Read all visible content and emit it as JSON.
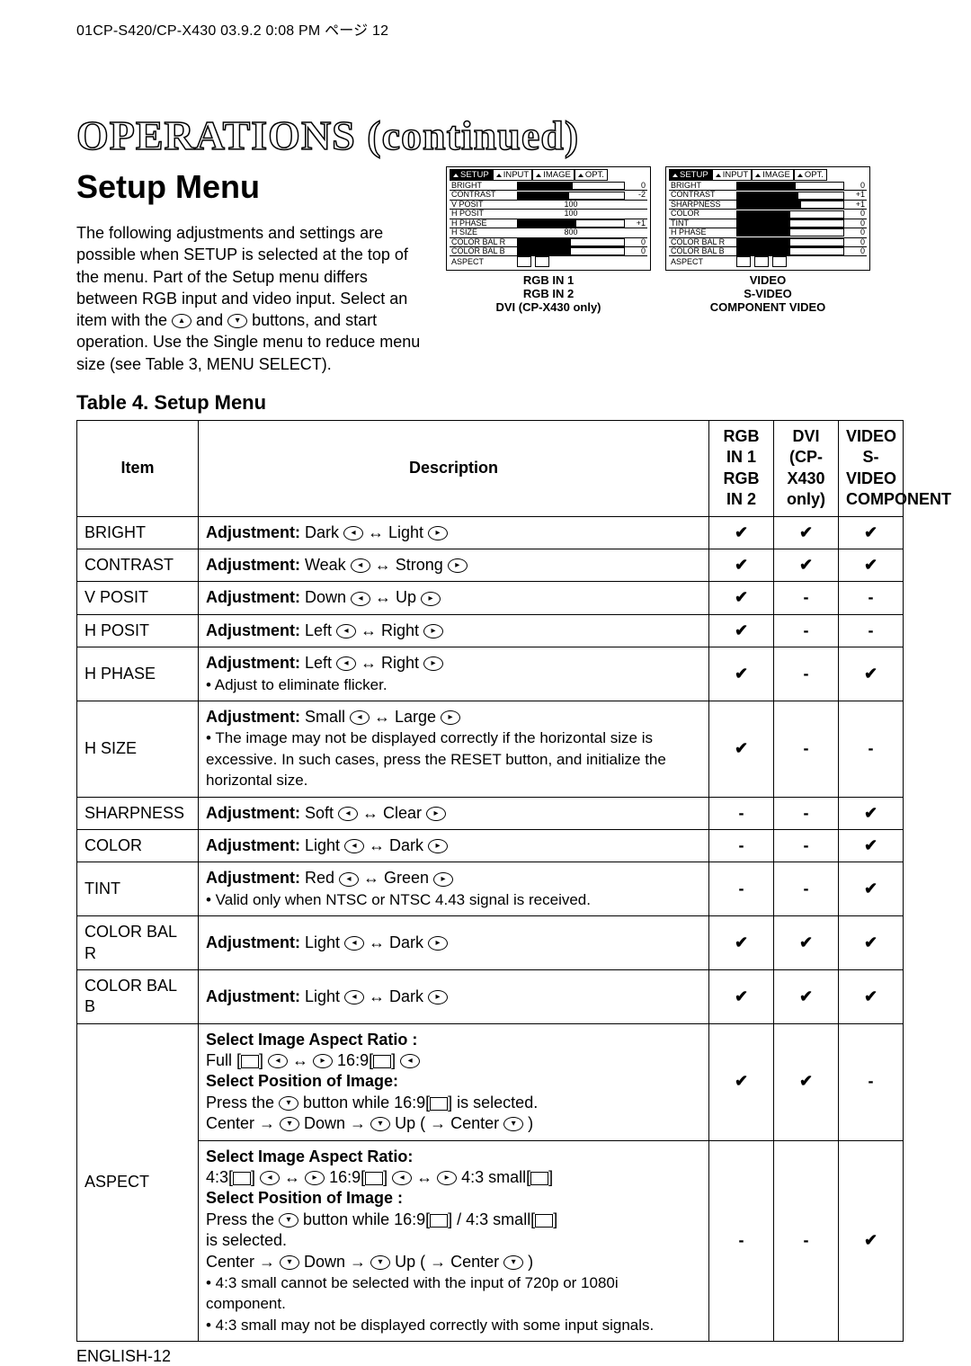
{
  "runhead": "01CP-S420/CP-X430  03.9.2 0:08 PM  ページ 12",
  "title": "OPERATIONS (continued)",
  "section": "Setup Menu",
  "lead_pre": "The following adjustments and settings are possible when SETUP is selected at the top of the menu. Part of the Setup menu differs between RGB input and video input. Select an item with the ",
  "lead_mid": " and ",
  "lead_post": " buttons, and start operation. Use the Single menu to reduce menu size (see Table 3, MENU SELECT).",
  "table_title": "Table 4. Setup Menu",
  "menus": {
    "tabs": [
      "SETUP",
      "INPUT",
      "IMAGE",
      "OPT."
    ],
    "left": {
      "rows": [
        {
          "n": "BRIGHT",
          "f": 52,
          "v": "0"
        },
        {
          "n": "CONTRAST",
          "f": 48,
          "v": "-2"
        },
        {
          "n": "V POSIT",
          "f": 0,
          "v": "100",
          "text": true
        },
        {
          "n": "H POSIT",
          "f": 0,
          "v": "100",
          "text": true
        },
        {
          "n": "H PHASE",
          "f": 55,
          "v": "+1"
        },
        {
          "n": "H SIZE",
          "f": 0,
          "v": "800",
          "text": true
        },
        {
          "n": "COLOR BAL R",
          "f": 50,
          "v": "0"
        },
        {
          "n": "COLOR BAL B",
          "f": 50,
          "v": "0"
        },
        {
          "n": "ASPECT",
          "aspect": true
        }
      ],
      "caption": "RGB IN 1\nRGB IN 2\nDVI (CP-X430 only)"
    },
    "right": {
      "rows": [
        {
          "n": "BRIGHT",
          "f": 55,
          "v": "0"
        },
        {
          "n": "CONTRAST",
          "f": 58,
          "v": "+1"
        },
        {
          "n": "SHARPNESS",
          "f": 60,
          "v": "+1"
        },
        {
          "n": "COLOR",
          "f": 50,
          "v": "0"
        },
        {
          "n": "TINT",
          "f": 50,
          "v": "0"
        },
        {
          "n": "H PHASE",
          "f": 50,
          "v": "0"
        },
        {
          "n": "COLOR BAL R",
          "f": 50,
          "v": "0"
        },
        {
          "n": "COLOR BAL B",
          "f": 50,
          "v": "0"
        },
        {
          "n": "ASPECT",
          "aspect": true,
          "three": true
        }
      ],
      "caption": "VIDEO\nS-VIDEO\nCOMPONENT VIDEO"
    }
  },
  "headers": {
    "item": "Item",
    "desc": "Description",
    "c1": "RGB IN 1\nRGB IN 2",
    "c2": "DVI\n(CP-\nX430\nonly)",
    "c3": "VIDEO\nS-VIDEO\nCOMPONENT"
  },
  "labels": {
    "adj": "Adjustment:"
  },
  "icons": {
    "left": "◂",
    "right": "▸",
    "up": "▴",
    "down": "▾",
    "darr": "↔"
  },
  "rows": [
    {
      "item": "BRIGHT",
      "desc": {
        "adj": true,
        "l": "Dark",
        "r": "Light"
      },
      "a": "✔",
      "b": "✔",
      "c": "✔"
    },
    {
      "item": "CONTRAST",
      "desc": {
        "adj": true,
        "l": "Weak",
        "r": "Strong"
      },
      "a": "✔",
      "b": "✔",
      "c": "✔"
    },
    {
      "item": "V POSIT",
      "desc": {
        "adj": true,
        "l": "Down",
        "r": "Up"
      },
      "a": "✔",
      "b": "-",
      "c": "-"
    },
    {
      "item": "H POSIT",
      "desc": {
        "adj": true,
        "l": "Left",
        "r": "Right"
      },
      "a": "✔",
      "b": "-",
      "c": "-"
    },
    {
      "item": "H PHASE",
      "desc": {
        "adj": true,
        "l": "Left",
        "r": "Right",
        "extra": "• Adjust to eliminate flicker."
      },
      "a": "✔",
      "b": "-",
      "c": "✔"
    },
    {
      "item": "H SIZE",
      "desc": {
        "adj": true,
        "l": "Small",
        "r": "Large",
        "extra": "• The image may not be displayed correctly if the horizontal size is excessive. In such cases, press the RESET button, and initialize the horizontal size."
      },
      "a": "✔",
      "b": "-",
      "c": "-"
    },
    {
      "item": "SHARPNESS",
      "desc": {
        "adj": true,
        "l": "Soft",
        "r": "Clear"
      },
      "a": "-",
      "b": "-",
      "c": "✔"
    },
    {
      "item": "COLOR",
      "desc": {
        "adj": true,
        "l": "Light",
        "r": "Dark"
      },
      "a": "-",
      "b": "-",
      "c": "✔"
    },
    {
      "item": "TINT",
      "desc": {
        "adj": true,
        "l": "Red",
        "r": "Green",
        "extra": "• Valid only when NTSC or NTSC 4.43 signal is received."
      },
      "a": "-",
      "b": "-",
      "c": "✔"
    },
    {
      "item": "COLOR BAL R",
      "desc": {
        "adj": true,
        "l": "Light",
        "r": "Dark"
      },
      "a": "✔",
      "b": "✔",
      "c": "✔"
    },
    {
      "item": "COLOR BAL B",
      "desc": {
        "adj": true,
        "l": "Light",
        "r": "Dark"
      },
      "a": "✔",
      "b": "✔",
      "c": "✔"
    }
  ],
  "aspect": {
    "item": "ASPECT",
    "top": {
      "h1": "Select Image Aspect Ratio :",
      "l1a": "Full [",
      "l1b": "] ",
      "l1c": " 16:9[",
      "l1d": "] ",
      "h2": "Select Position of Image:",
      "l2a": "Press the ",
      "l2b": " button while 16:9[",
      "l2c": "] is selected.",
      "l3a": "Center → ",
      "l3b": " Down → ",
      "l3c": " Up ( → Center ",
      "l3d": " )",
      "a": "✔",
      "b": "✔",
      "c": "-"
    },
    "bot": {
      "h1": "Select Image Aspect Ratio:",
      "l1a": "4:3[",
      "l1b": "] ",
      "l1c": " 16:9[",
      "l1d": "] ",
      "l1e": " 4:3 small[",
      "l1f": "]",
      "h2": "Select Position of Image :",
      "l2a": "Press the ",
      "l2b": " button while 16:9[",
      "l2c": "] / 4:3 small[",
      "l2d": "]",
      "l2e": "is selected.",
      "l3a": "Center → ",
      "l3b": " Down → ",
      "l3c": " Up ( → Center ",
      "l3d": " )",
      "n1": "• 4:3 small cannot be selected with the input of 720p or 1080i component.",
      "n2": "• 4:3 small may not be displayed correctly with some input signals.",
      "a": "-",
      "b": "-",
      "c": "✔"
    }
  },
  "footer": "ENGLISH-12"
}
